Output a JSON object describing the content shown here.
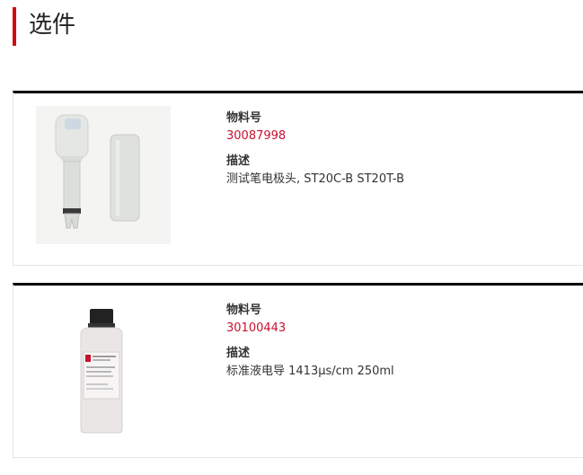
{
  "section": {
    "title": "选件"
  },
  "products": [
    {
      "part_label": "物料号",
      "part_number": "30087998",
      "desc_label": "描述",
      "description": "测试笔电极头, ST20C-B ST20T-B",
      "image_icon": "electrode-head-image"
    },
    {
      "part_label": "物料号",
      "part_number": "30100443",
      "desc_label": "描述",
      "description": "标准液电导 1413µs/cm 250ml",
      "image_icon": "solution-bottle-image"
    }
  ],
  "colors": {
    "accent": "#d10a11",
    "part_number": "#c8102e",
    "card_border": "#000000"
  }
}
